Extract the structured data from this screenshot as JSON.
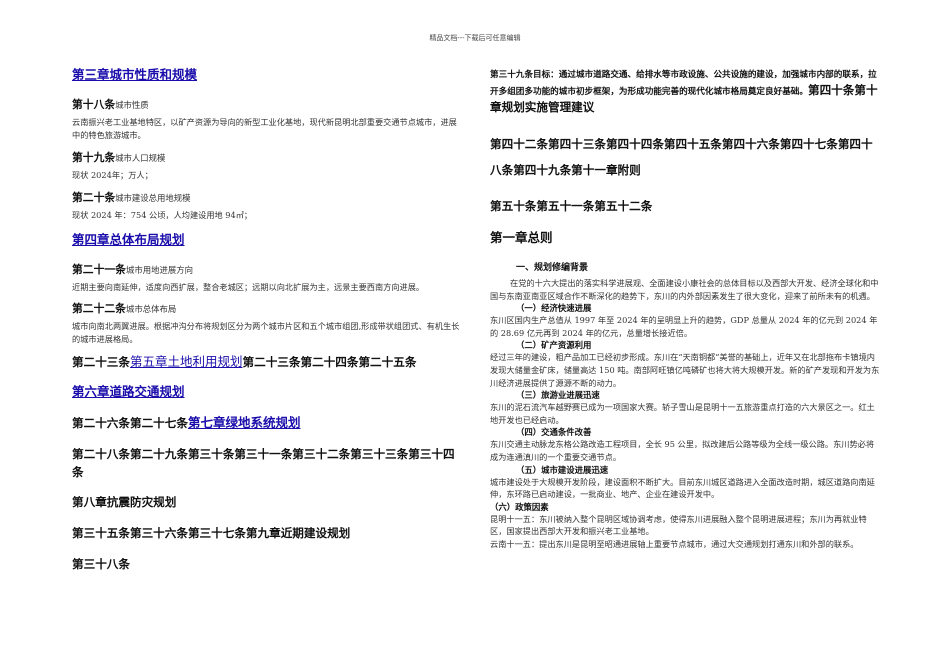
{
  "header": {
    "note": "精品文档---下载后可任意编辑"
  },
  "left": {
    "ch3_title": "第三章城市性质和规模",
    "a18_num": "第十八条",
    "a18_title": "城市性质",
    "a18_body": "云南振兴老工业基地特区，以矿产资源为导向的新型工业化基地，现代新昆明北部重要交通节点城市，进展中的特色旅游城市。",
    "a19_num": "第十九条",
    "a19_title": "城市人口规模",
    "a19_body": "现状 2024年；万人；",
    "a20_num": "第二十条",
    "a20_title": "城市建设总用地规模",
    "a20_body": "现状 2024 年：754 公顷，人均建设用地 94㎡；",
    "ch4_title": "第四章总体布局规划",
    "a21_num": "第二十一条",
    "a21_title": "城市用地进展方向",
    "a21_body": "近期主要向南延伸，适度向西扩展，整合老城区；远期以向北扩展为主，远景主要西南方向进展。",
    "a22_num": "第二十二条",
    "a22_title": "城市总体布局",
    "a22_body": "城市向南北两翼进展。根据冲沟分布将规划区分为两个城市片区和五个城市组团,形成带状组团式、有机生长的城市进展格局。",
    "a23_prefix": "第二十三条",
    "ch5_link": "第五章土地利用规划",
    "a23_suffix": "第二十三条第二十四条第二十五条",
    "ch6_title": "第六章道路交通规划",
    "a26_prefix": "第二十六条第二十七条",
    "ch7_link": "第七章绿地系统规划",
    "line28": "第二十八条第二十九条第三十条第三十一条第三十二条第三十三条第三十四条",
    "ch8": "第八章抗震防灾规划",
    "line35": "第三十五条第三十六条第三十七条第九章近期建设规划",
    "line38": "第三十八条"
  },
  "right": {
    "a39_intro": "第三十九条目标：通过城市道路交通、给排水等市政设施、公共设施的建设，加强城市内部的联系，拉开多组团多功能的城市初步框架，为形成功能完善的现代化城市格局奠定良好基础。",
    "a40_tail": "第四十条第十章规划实施管理建议",
    "line42": "第四十二条第四十三条第四十四条第四十五条第四十六条第四十七条第四十八条第四十九条第十一章附则",
    "line50": "第五十条第五十一条第五十二条",
    "ch1": "第一章总则",
    "s1_title": "一、规划修编背景",
    "s1_body": "在党的十六大提出的落实科学进展观、全面建设小康社会的总体目标以及西部大开发、经济全球化和中国与东南亚南亚区域合作不断深化的趋势下，东川的内外部因素发生了很大变化，迎来了前所未有的机遇。",
    "sub1": "（一）经济快速进展",
    "sub1_body": "东川区国内生产总值从 1997 年至 2024 年的呈明显上升的趋势，GDP 总量从 2024 年的亿元到 2024 年的 28.69 亿元再到 2024 年的亿元，总量增长接近倍。",
    "sub2": "（二）矿产资源利用",
    "sub2_body": "经过三年的建设，粗产品加工已经初步形成。东川在“天南铜都”美誉的基础上，近年又在北部拖布卡镇境内发现大储量金矿床，储量高达 150 吨。南部阿旺镇亿吨磷矿也将大将大规模开发。新的矿产发现和开发为东川经济进展提供了源源不断的动力。",
    "sub3": "（三）旅游业进展迅速",
    "sub3_body": "东川的泥石流汽车越野赛已成为一项国家大赛。轿子雪山是昆明十一五旅游重点打造的六大景区之一。红土地开发也已经启动。",
    "sub4": "（四）交通条件改善",
    "sub4_body": "东川交通主动脉龙东格公路改造工程项目，全长 95 公里，拟改建后公路等级为全线一级公路。东川势必将成为连通滇川的一个重要交通节点。",
    "sub5": "（五）城市建设进展迅速",
    "sub5_body": "城市建设处于大规模开发阶段，建设面积不断扩大。目前东川城区道路进入全面改造时期，城区道路向南延伸，东环路已启动建设，一批商业、地产、企业在建设开发中。",
    "sub6": "（六）政策因素",
    "sub6_body1": "昆明十一五：东川被纳入整个昆明区域协调考虑，使得东川进展融入整个昆明进展进程；东川为再就业特区，国家提出西部大开发和振兴老工业基地。",
    "sub6_body2": "云南十一五：提出东川是昆明至昭通进展轴上重要节点城市，通过大交通规划打通东川和外部的联系。"
  }
}
